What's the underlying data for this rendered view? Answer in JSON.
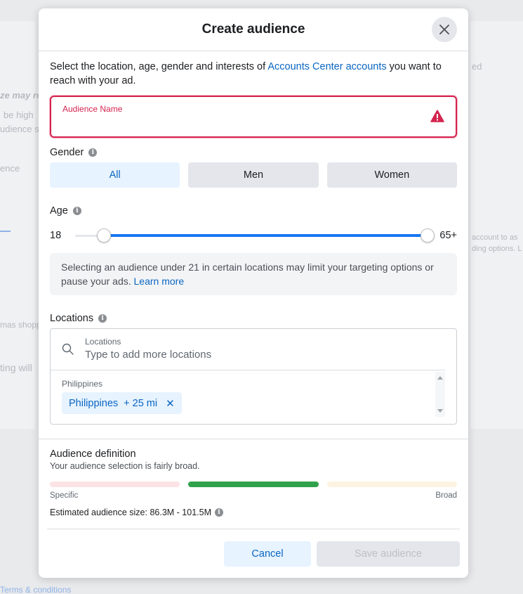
{
  "background": {
    "texts": [
      "ze may re",
      "be high",
      "udience s",
      "ence",
      "ed",
      "mas shopp",
      "ting will",
      "account to as",
      "ding options. L",
      "Terms & conditions"
    ]
  },
  "modal": {
    "title": "Create audience",
    "intro_before": "Select the location, age, gender and interests of ",
    "intro_link": "Accounts Center accounts",
    "intro_after": " you want to reach with your ad.",
    "audience_name": {
      "label": "Audience Name",
      "value": "",
      "state": "error"
    },
    "gender": {
      "label": "Gender",
      "options": [
        "All",
        "Men",
        "Women"
      ],
      "selected": "All"
    },
    "age": {
      "label": "Age",
      "min_label": "18",
      "max_label": "65+",
      "range_min": 18,
      "range_max": 65,
      "low": 21,
      "high": 65
    },
    "notice": {
      "text": "Selecting an audience under 21 in certain locations may limit your targeting options or pause your ads. ",
      "link": "Learn more"
    },
    "locations": {
      "label": "Locations",
      "search_label": "Locations",
      "placeholder": "Type to add more locations",
      "group_label": "Philippines",
      "chip_name": "Philippines",
      "chip_radius": "+ 25 mi"
    },
    "definition": {
      "title": "Audience definition",
      "subtitle": "Your audience selection is fairly broad.",
      "specific_label": "Specific",
      "broad_label": "Broad",
      "level": "fairly broad",
      "estimate": "Estimated audience size: 86.3M - 101.5M"
    },
    "buttons": {
      "cancel": "Cancel",
      "save": "Save audience"
    }
  },
  "colors": {
    "accent": "#0a66c2",
    "error": "#d4244f",
    "meter_specific": "#fde3e6",
    "meter_active": "#31a24c",
    "meter_broad": "#fdf3e2"
  }
}
